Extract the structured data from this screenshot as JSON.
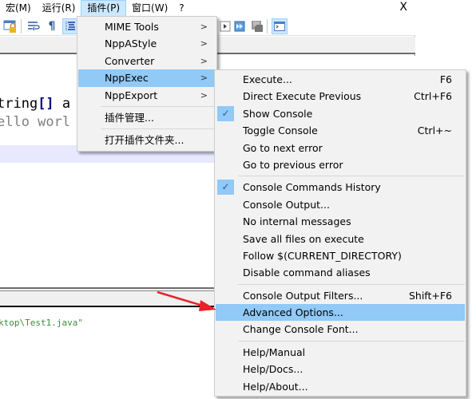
{
  "menubar": {
    "items": [
      {
        "label": "宏(M)"
      },
      {
        "label": "运行(R)"
      },
      {
        "label": "插件(P)",
        "active": true
      },
      {
        "label": "窗口(W)"
      },
      {
        "label": "?"
      }
    ],
    "close_label": "X"
  },
  "toolbar": {
    "icons": [
      "lock-window-icon",
      "word-wrap-icon",
      "show-all-chars-icon",
      "indent-guide-icon",
      "play-macro-icon",
      "run-macro-multiple-icon",
      "save-macro-icon",
      "console-icon"
    ]
  },
  "editor": {
    "line1_pre": "tring",
    "line1_brackets": "[]",
    "line1_post": " a",
    "line2": "ello worl"
  },
  "console": {
    "output_line": "ktop\\Test1.java\""
  },
  "plugins_menu": {
    "items": [
      {
        "label": "MIME Tools",
        "submenu": true
      },
      {
        "label": "NppAStyle",
        "submenu": true
      },
      {
        "label": "Converter",
        "submenu": true
      },
      {
        "label": "NppExec",
        "submenu": true,
        "highlighted": true
      },
      {
        "label": "NppExport",
        "submenu": true
      },
      {
        "label": "插件管理..."
      },
      {
        "label": "打开插件文件夹..."
      }
    ],
    "arrow_glyph": ">"
  },
  "nppexec_menu": {
    "groups": [
      [
        {
          "label": "Execute...",
          "shortcut": "F6"
        },
        {
          "label": "Direct Execute Previous",
          "shortcut": "Ctrl+F6"
        },
        {
          "label": "Show Console",
          "checked": true
        },
        {
          "label": "Toggle Console",
          "shortcut": "Ctrl+~"
        },
        {
          "label": "Go to next error"
        },
        {
          "label": "Go to previous error"
        }
      ],
      [
        {
          "label": "Console Commands History",
          "checked": true
        },
        {
          "label": "Console Output..."
        },
        {
          "label": "No internal messages"
        },
        {
          "label": "Save all files on execute"
        },
        {
          "label": "Follow $(CURRENT_DIRECTORY)"
        },
        {
          "label": "Disable command aliases"
        }
      ],
      [
        {
          "label": "Console Output Filters...",
          "shortcut": "Shift+F6"
        },
        {
          "label": "Advanced Options...",
          "highlighted": true
        },
        {
          "label": "Change Console Font..."
        }
      ],
      [
        {
          "label": "Help/Manual"
        },
        {
          "label": "Help/Docs..."
        },
        {
          "label": "Help/About..."
        }
      ]
    ],
    "check_glyph": "✓"
  },
  "colors": {
    "highlight": "#91c9f7",
    "menu_bg": "#f2f2f2",
    "annotation_arrow": "#e8222a",
    "console_text": "#3a8f3a"
  }
}
